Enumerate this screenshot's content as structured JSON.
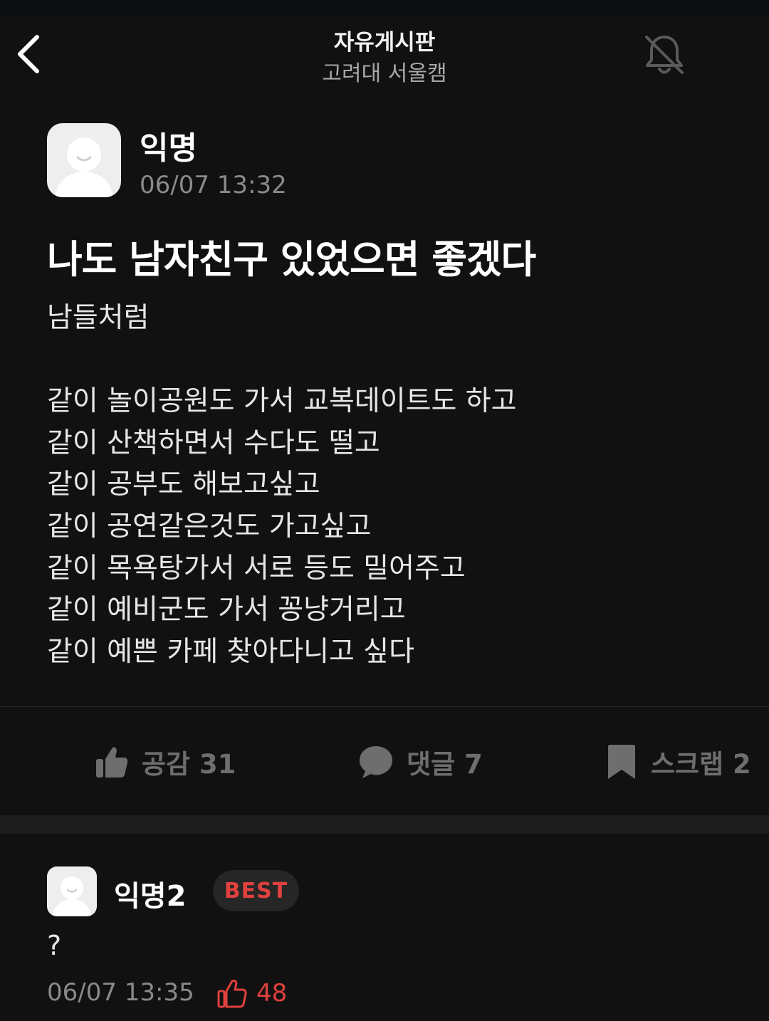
{
  "header": {
    "board_title": "자유게시판",
    "board_subtitle": "고려대 서울캠",
    "icons": {
      "back": "chevron-left-icon",
      "notify": "bell-off-icon"
    }
  },
  "post": {
    "author": "익명",
    "time": "06/07 13:32",
    "title": "나도 남자친구 있었으면 좋겠다",
    "body_lines": [
      "남들처럼",
      "",
      "같이 놀이공원도 가서 교복데이트도 하고",
      "같이 산책하면서 수다도 떨고",
      "같이 공부도 해보고싶고",
      "같이 공연같은것도 가고싶고",
      "같이 목욕탕가서 서로 등도 밀어주고",
      "같이 예비군도 가서 꽁냥거리고",
      "같이 예쁜 카페 찾아다니고 싶다"
    ]
  },
  "actions": {
    "like_label": "공감 31",
    "comment_label": "댓글 7",
    "scrap_label": "스크랩 2",
    "icons": {
      "like": "thumbs-up-icon",
      "comment": "speech-bubble-icon",
      "scrap": "bookmark-icon"
    }
  },
  "comment": {
    "author": "익명2",
    "badge": "BEST",
    "text": "?",
    "time": "06/07 13:35",
    "likes": "48",
    "icons": {
      "like": "thumbs-up-outline-icon"
    }
  },
  "colors": {
    "background": "#111111",
    "accent_red": "#e0413e",
    "muted_text": "#8a8a8a",
    "action_gray": "#6e6e6e"
  }
}
